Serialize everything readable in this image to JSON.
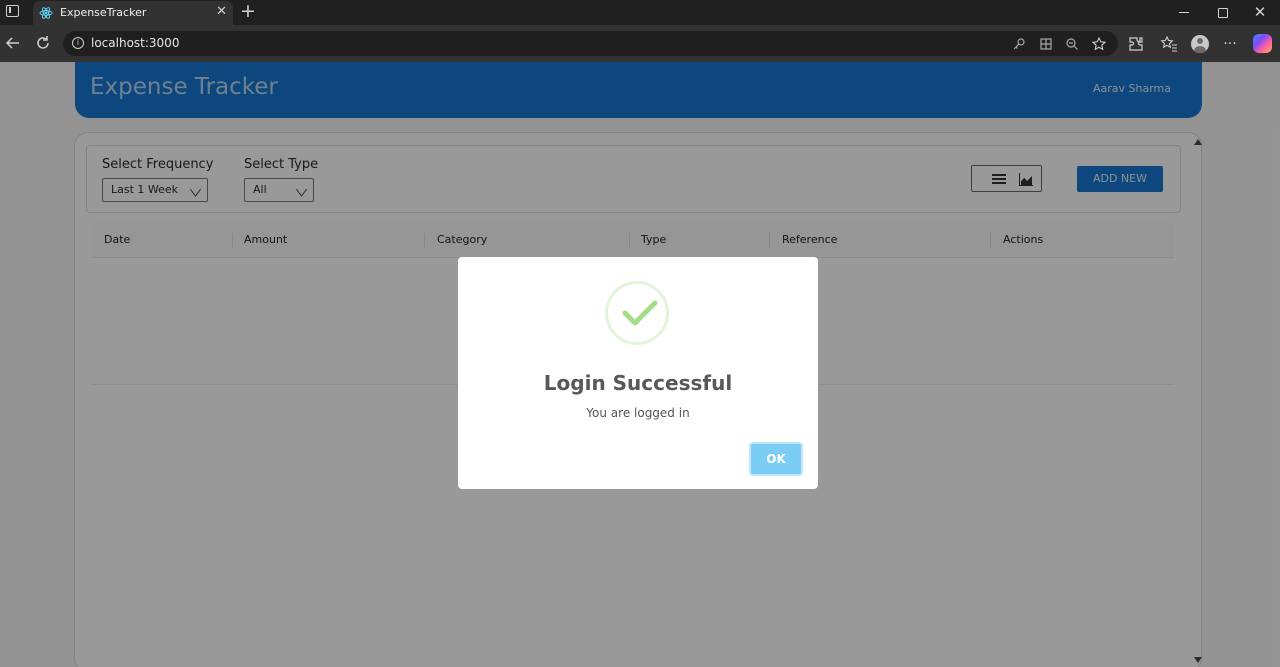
{
  "browser": {
    "tab_title": "ExpenseTracker",
    "tab_close": "✕",
    "new_tab": "+",
    "url": "localhost:3000"
  },
  "icons": {
    "tab_favicon": "react-logo-icon",
    "back": "arrow-left-icon",
    "reload": "reload-icon",
    "site_info": "info-icon",
    "address_actions": [
      "key-icon",
      "grid-icon",
      "zoom-out-icon",
      "star-icon"
    ],
    "toolbar_actions": [
      "extensions-icon",
      "favorites-icon",
      "profile-icon",
      "more-icon",
      "copilot-icon"
    ],
    "view_list": "list-icon",
    "view_chart": "area-chart-icon",
    "success": "check-icon"
  },
  "header": {
    "title": "Expense Tracker",
    "user": "Aarav Sharma"
  },
  "filters": {
    "frequency_label": "Select Frequency",
    "frequency_value": "Last 1 Week",
    "type_label": "Select Type",
    "type_value": "All"
  },
  "actions": {
    "add_new": "ADD NEW"
  },
  "table": {
    "columns": [
      "Date",
      "Amount",
      "Category",
      "Type",
      "Reference",
      "Actions"
    ],
    "rows": []
  },
  "modal": {
    "title": "Login Successful",
    "text": "You are logged in",
    "ok_label": "OK"
  },
  "colors": {
    "brand_blue": "#1677d2",
    "success_green": "#a5dc86",
    "ok_button": "#7ccdf5",
    "overlay": "rgba(0,0,0,0.4)"
  }
}
